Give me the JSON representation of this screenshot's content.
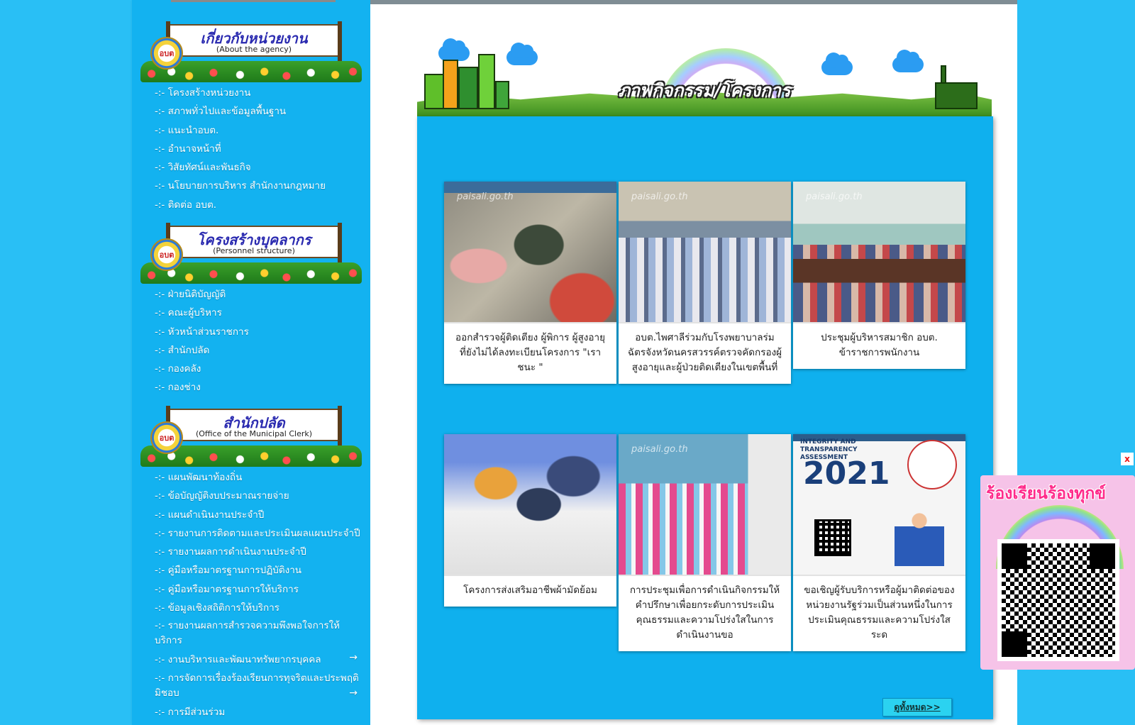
{
  "sidebar": {
    "sections": [
      {
        "title_th": "เกี่ยวกับหน่วยงาน",
        "title_en": "(About the agency)",
        "seal": "อบต",
        "items": [
          "-:- โครงสร้างหน่วยงาน",
          "-:- สภาพทั่วไปและข้อมูลพื้นฐาน",
          "-:- แนะนำอบต.",
          "-:- อำนาจหน้าที่",
          "-:- วิสัยทัศน์และพันธกิจ",
          "-:- นโยบายการบริหาร สำนักงานกฎหมาย",
          "-:- ติดต่อ อบต."
        ]
      },
      {
        "title_th": "โครงสร้างบุคลากร",
        "title_en": "(Personnel structure)",
        "seal": "อบต",
        "items": [
          "-:- ฝ่ายนิติบัญญัติ",
          "-:- คณะผู้บริหาร",
          "-:- หัวหน้าส่วนราชการ",
          "-:- สำนักปลัด",
          "-:- กองคลัง",
          "-:- กองช่าง"
        ]
      },
      {
        "title_th": "สำนักปลัด",
        "title_en": "(Office of the Municipal Clerk)",
        "seal": "อบต",
        "items": [
          "-:- แผนพัฒนาท้องถิ่น",
          "-:- ข้อบัญญัติงบประมาณรายจ่าย",
          "-:- แผนดำเนินงานประจำปี",
          "-:- รายงานการติดตามและประเมินผลแผนประจำปี",
          "-:- รายงานผลการดำเนินงานประจำปี",
          "-:- คู่มือหรือมาตรฐานการปฏิบัติงาน",
          "-:- คู่มือหรือมาตรฐานการให้บริการ",
          "-:- ข้อมูลเชิงสถิติการให้บริการ",
          "-:- รายงานผลการสำรวจความพึงพอใจการให้บริการ",
          "-:- งานบริหารและพัฒนาทรัพยากรบุคคล",
          "-:- การจัดการเรื่องร้องเรียนการทุจริตและประพฤติมิชอบ",
          "-:- การมีส่วนร่วม"
        ],
        "arrow": "→"
      }
    ]
  },
  "activities": {
    "title": "ภาพกิจกรรม/โครงการ",
    "watermark": "paisali.go.th",
    "cards": [
      {
        "caption": "ออกสำรวจผู้ติดเตียง ผู้พิการ ผู้สูงอายุ ที่ยังไม่ได้ลงทะเบียนโครงการ \"เราชนะ \""
      },
      {
        "caption": "อบต.ไพศาลีร่วมกับโรงพยาบาลร่มฉัตรจังหวัดนครสวรรค์ตรวจคัดกรองผู้สูงอายุและผู้ป่วยติดเตียงในเขตพื้นที่"
      },
      {
        "caption": "ประชุมผู้บริหารสมาชิก อบต. ข้าราชการพนักงาน"
      },
      {
        "caption": "โครงการส่งเสริมอาชีพผ้ามัดย้อม"
      },
      {
        "caption": "การประชุมเพื่อการดำเนินกิจกรรมให้คำปรึกษาเพื่อยกระดับการประเมินคุณธรรมและความโปร่งใสในการดำเนินงานขอ"
      },
      {
        "caption": "ขอเชิญผู้รับบริการหรือผู้มาติดต่อของหน่วยงานรัฐร่วมเป็นส่วนหนึ่งในการประเมินคุณธรรมและความโปร่งใสระด"
      }
    ],
    "poster": {
      "header": "INTEGRITY AND TRANSPARENCY ASSESSMENT",
      "year": "2021"
    },
    "view_all": "ดูทั้งหมด>>"
  },
  "qr_widget": {
    "title": "ร้องเรียนร้องทุกข์",
    "close": "x"
  },
  "colors": {
    "page_bg": "#29bff5",
    "sidebar_bg": "#13b2f0",
    "panel_bg": "#0fb0ee",
    "widget_pink": "#f6c3e8"
  }
}
